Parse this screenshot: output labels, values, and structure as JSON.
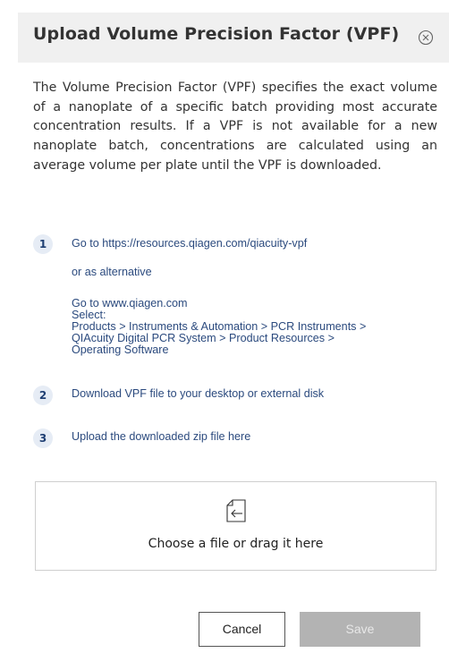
{
  "dialog": {
    "title": "Upload Volume Precision Factor (VPF)",
    "description": "The Volume Precision Factor (VPF) specifies the exact volume of a nanoplate of a specific batch providing most accurate concentration results. If a VPF is not available for a new nanoplate batch, concentrations are calculated using an average volume per plate until the VPF is downloaded."
  },
  "steps": [
    {
      "number": "1",
      "lines": [
        "Go to https://resources.qiagen.com/qiacuity-vpf",
        "or as alternative",
        "Go to www.qiagen.com",
        "Select:",
        "Products > Instruments & Automation > PCR Instruments >",
        "QIAcuity Digital PCR System > Product Resources >",
        "Operating Software"
      ]
    },
    {
      "number": "2",
      "text": "Download VPF file to your desktop or external disk"
    },
    {
      "number": "3",
      "text": "Upload the downloaded zip file here"
    }
  ],
  "dropzone": {
    "label": "Choose a file or drag it here"
  },
  "buttons": {
    "cancel": "Cancel",
    "save": "Save"
  },
  "colors": {
    "step_text": "#2b4a7e",
    "badge_bg": "#e6ecf5",
    "header_bg": "#f0f0f0",
    "save_disabled": "#b3b3b3"
  }
}
